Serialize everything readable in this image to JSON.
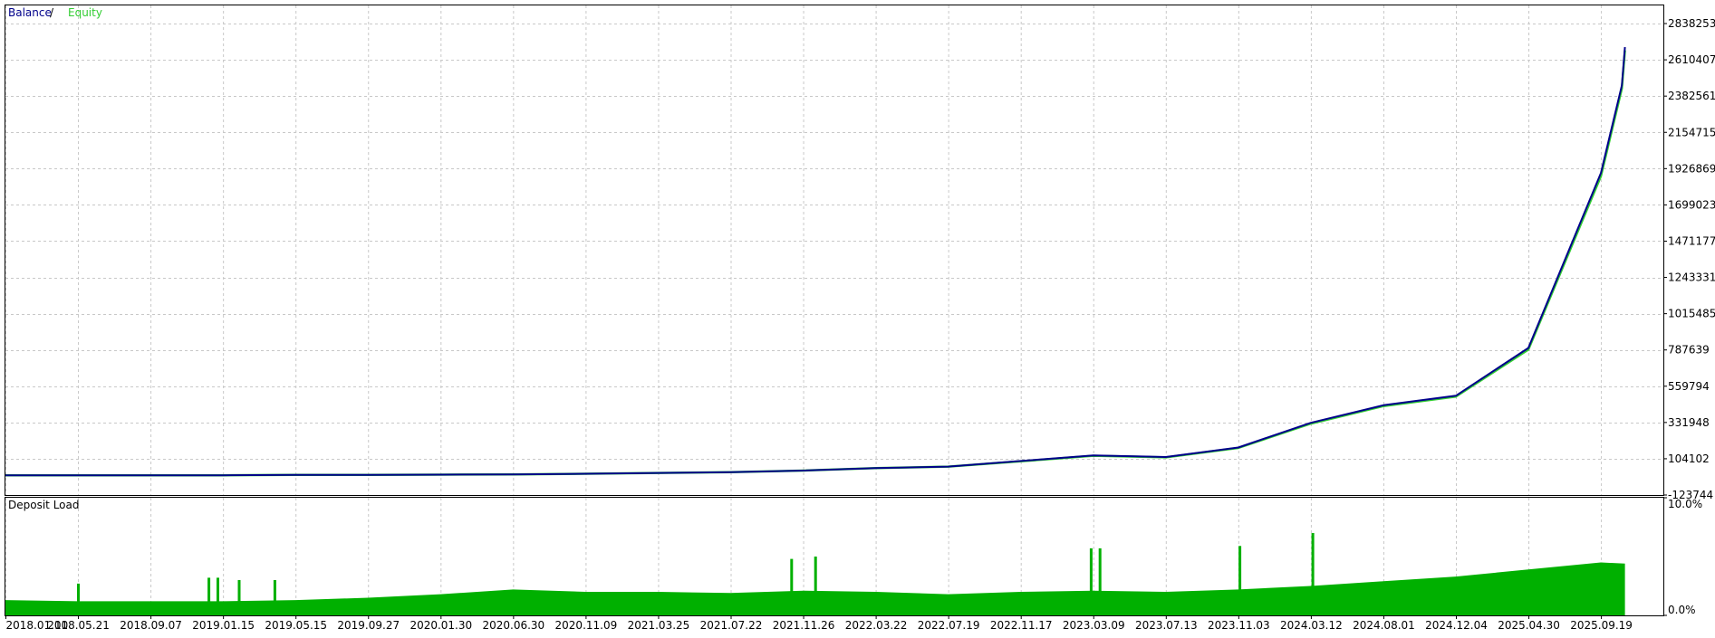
{
  "chart_data": [
    {
      "type": "line",
      "legend": {
        "placement": "top-left",
        "separator": " / "
      },
      "y_ticks": [
        "2838253",
        "2610407",
        "2382561",
        "2154715",
        "1926869",
        "1699023",
        "1471177",
        "1243331",
        "1015485",
        "787639",
        "559794",
        "331948",
        "104102",
        "-123744"
      ],
      "y_tick_values": [
        2838253,
        2610407,
        2382561,
        2154715,
        1926869,
        1699023,
        1471177,
        1243331,
        1015485,
        787639,
        559794,
        331948,
        104102,
        -123744
      ],
      "ylim": [
        -123744,
        2952176
      ],
      "x_ticks": [
        "2018.01.10",
        "2018.05.21",
        "2018.09.07",
        "2019.01.15",
        "2019.05.15",
        "2019.09.27",
        "2020.01.30",
        "2020.06.30",
        "2020.11.09",
        "2021.03.25",
        "2021.07.22",
        "2021.11.26",
        "2022.03.22",
        "2022.07.19",
        "2022.11.17",
        "2023.03.09",
        "2023.07.13",
        "2023.11.03",
        "2024.03.12",
        "2024.08.01",
        "2024.12.04",
        "2025.04.30",
        "2025.09.19"
      ],
      "grid": true,
      "series": [
        {
          "name": "Balance",
          "color": "#00008B",
          "x": [
            "2018.01.10",
            "2018.05.21",
            "2018.09.07",
            "2019.01.15",
            "2019.05.15",
            "2019.09.27",
            "2020.01.30",
            "2020.06.30",
            "2020.11.09",
            "2021.03.25",
            "2021.07.22",
            "2021.11.26",
            "2022.03.22",
            "2022.07.19",
            "2022.11.17",
            "2023.03.09",
            "2023.07.13",
            "2023.11.03",
            "2024.03.12",
            "2024.08.01",
            "2024.12.04",
            "2025.04.30",
            "2025.09.19",
            "2025.10.30",
            "2025.11.05"
          ],
          "values": [
            0,
            0,
            0,
            0,
            3000,
            3000,
            4000,
            6000,
            10000,
            15000,
            20000,
            30000,
            45000,
            55000,
            90000,
            125000,
            115000,
            175000,
            330000,
            440000,
            500000,
            800000,
            1900000,
            2450000,
            2690000
          ]
        },
        {
          "name": "Equity",
          "color": "#32CD32",
          "x": [
            "2018.01.10",
            "2018.05.21",
            "2018.09.07",
            "2019.01.15",
            "2019.05.15",
            "2019.09.27",
            "2020.01.30",
            "2020.06.30",
            "2020.11.09",
            "2021.03.25",
            "2021.07.22",
            "2021.11.26",
            "2022.03.22",
            "2022.07.19",
            "2022.11.17",
            "2023.03.09",
            "2023.07.13",
            "2023.11.03",
            "2024.03.12",
            "2024.08.01",
            "2024.12.04",
            "2025.04.30",
            "2025.09.19",
            "2025.10.30",
            "2025.11.05"
          ],
          "values": [
            0,
            0,
            0,
            0,
            3000,
            3000,
            4000,
            6000,
            10000,
            15000,
            20000,
            30000,
            45000,
            55000,
            88000,
            123000,
            113000,
            172000,
            325000,
            435000,
            495000,
            790000,
            1880000,
            2430000,
            2670000
          ]
        }
      ]
    },
    {
      "type": "bar",
      "title": "Deposit Load",
      "y_ticks": [
        "10.0%",
        "0.0%"
      ],
      "y_tick_values": [
        10,
        0
      ],
      "ylim": [
        0,
        10
      ],
      "grid": true,
      "series": [
        {
          "name": "Deposit Load",
          "color": "#00B000",
          "x": [
            "2018.01.10",
            "2018.05.21",
            "2018.09.07",
            "2019.01.15",
            "2019.05.15",
            "2019.09.27",
            "2020.01.30",
            "2020.06.30",
            "2020.11.09",
            "2021.03.25",
            "2021.07.22",
            "2021.11.26",
            "2022.03.22",
            "2022.07.19",
            "2022.11.17",
            "2023.03.09",
            "2023.07.13",
            "2023.11.03",
            "2024.03.12",
            "2024.08.01",
            "2024.12.04",
            "2025.04.30",
            "2025.09.19",
            "2025.11.05"
          ],
          "values": [
            1.3,
            1.2,
            1.2,
            1.2,
            1.3,
            1.5,
            1.8,
            2.2,
            2.0,
            2.0,
            1.9,
            2.1,
            2.0,
            1.8,
            2.0,
            2.1,
            2.0,
            2.2,
            2.5,
            2.9,
            3.3,
            3.9,
            4.5,
            4.4
          ]
        },
        {
          "name": "Deposit Load spikes",
          "color": "#00B000",
          "x": [
            "2018.05.21",
            "2018.12.20",
            "2019.01.05",
            "2019.02.10",
            "2019.04.10",
            "2021.11.05",
            "2021.12.15",
            "2023.03.05",
            "2023.03.20",
            "2023.11.05",
            "2024.03.15"
          ],
          "values": [
            2.7,
            3.2,
            3.2,
            3.0,
            3.0,
            4.8,
            5.0,
            5.7,
            5.7,
            5.9,
            7.0
          ]
        }
      ]
    }
  ]
}
